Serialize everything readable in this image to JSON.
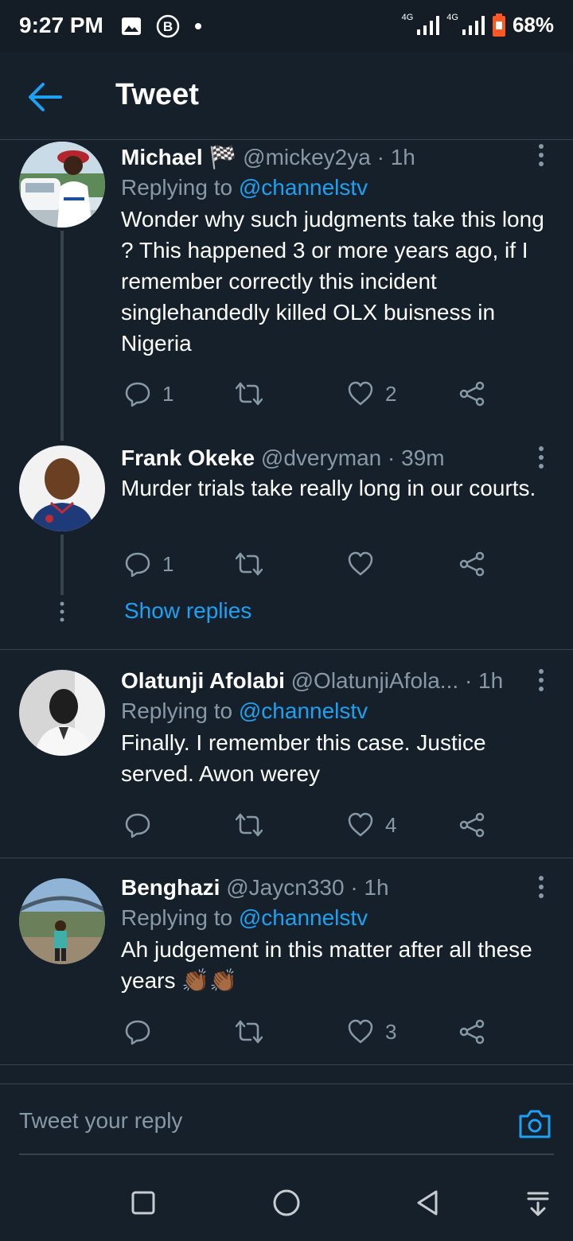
{
  "status": {
    "time": "9:27 PM",
    "net1": "4G",
    "net2": "4G",
    "battery": "68%"
  },
  "header": {
    "title": "Tweet"
  },
  "tweets": [
    {
      "name": "Michael",
      "badge": "🏁",
      "handle": "@mickey2ya",
      "time": "· 1h",
      "reply_prefix": "Replying to",
      "reply_to": "@channelstv",
      "text": "Wonder why such judgments take this long ? This happened 3 or more years ago, if I remember correctly this incident singlehandedly killed OLX buisness in Nigeria",
      "replies": "1",
      "retweets": "",
      "likes": "2"
    },
    {
      "name": "Frank Okeke",
      "handle": "@dveryman",
      "time": "· 39m",
      "text": "Murder trials take really long in our courts.",
      "replies": "1",
      "retweets": "",
      "likes": ""
    },
    {
      "name": "Olatunji Afolabi",
      "handle": "@OlatunjiAfola...",
      "time": "· 1h",
      "reply_prefix": "Replying to",
      "reply_to": "@channelstv",
      "text": "Finally. I remember this case. Justice served. Awon werey",
      "replies": "",
      "retweets": "",
      "likes": "4"
    },
    {
      "name": "Benghazi",
      "handle": "@Jaycn330",
      "time": "· 1h",
      "reply_prefix": "Replying to",
      "reply_to": "@channelstv",
      "text": "Ah judgement in this matter after all these years 👏🏾👏🏾",
      "replies": "",
      "retweets": "",
      "likes": "3"
    }
  ],
  "show_replies": "Show replies",
  "reply_bar": {
    "placeholder": "Tweet your reply"
  },
  "colors": {
    "background": "#15202b",
    "accent": "#1da1f2",
    "muted": "#8899a6",
    "divider": "#38444d"
  }
}
